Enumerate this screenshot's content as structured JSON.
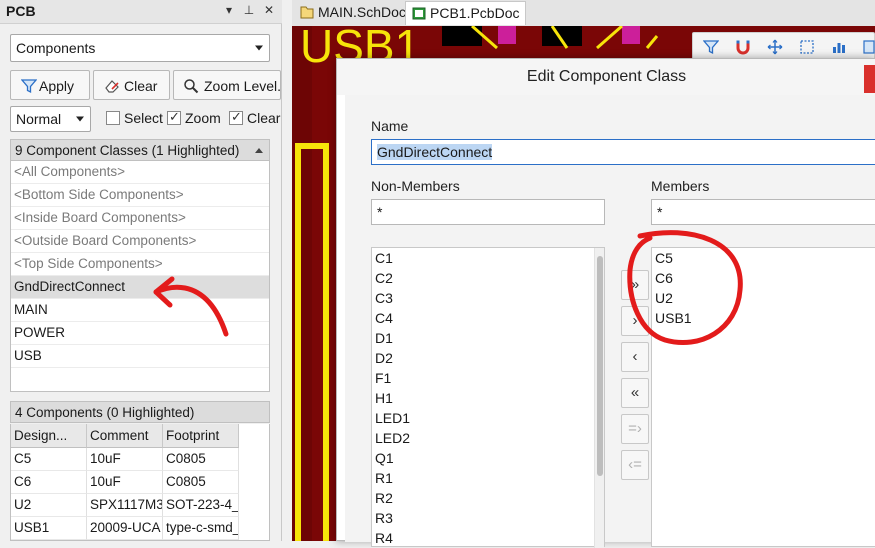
{
  "panel": {
    "title": "PCB",
    "header_buttons": [
      "▾",
      "⊥",
      "✕"
    ],
    "mode_select": "Components",
    "apply_label": "Apply",
    "clear_label": "Clear",
    "zoom_level_label": "Zoom Level...",
    "mask_mode": "Normal",
    "checkboxes": [
      {
        "label": "Select",
        "checked": false
      },
      {
        "label": "Zoom",
        "checked": true
      },
      {
        "label": "Clear",
        "checked": true
      }
    ]
  },
  "classes": {
    "header": "9 Component Classes (1 Highlighted)",
    "items": [
      {
        "label": "<All Components>",
        "special": true
      },
      {
        "label": "<Bottom Side Components>",
        "special": true
      },
      {
        "label": "<Inside Board Components>",
        "special": true
      },
      {
        "label": "<Outside Board Components>",
        "special": true
      },
      {
        "label": "<Top Side Components>",
        "special": true
      },
      {
        "label": "GndDirectConnect",
        "selected": true
      },
      {
        "label": "MAIN"
      },
      {
        "label": "POWER"
      },
      {
        "label": "USB"
      }
    ]
  },
  "components": {
    "header": "4 Components (0 Highlighted)",
    "columns": [
      "Design...",
      "Comment",
      "Footprint"
    ],
    "rows": [
      [
        "C5",
        "10uF",
        "C0805"
      ],
      [
        "C6",
        "10uF",
        "C0805"
      ],
      [
        "U2",
        "SPX1117M3",
        "SOT-223-4_"
      ],
      [
        "USB1",
        "20009-UCA",
        "type-c-smd_"
      ]
    ]
  },
  "tabs": [
    {
      "label": "MAIN.SchDoc",
      "active": false
    },
    {
      "label": "PCB1.PcbDoc",
      "active": true
    }
  ],
  "canvas": {
    "background_color": "#7a0606",
    "trace_color": "#f7e40a",
    "silk_text": "USB1"
  },
  "dialog": {
    "title": "Edit Component Class",
    "name_label": "Name",
    "name_value": "GndDirectConnect",
    "non_members_label": "Non-Members",
    "non_members_filter": "*",
    "members_label": "Members",
    "members_filter": "*",
    "non_members": [
      "C1",
      "C2",
      "C3",
      "C4",
      "D1",
      "D2",
      "F1",
      "H1",
      "LED1",
      "LED2",
      "Q1",
      "R1",
      "R2",
      "R3",
      "R4"
    ],
    "members": [
      "C5",
      "C6",
      "U2",
      "USB1"
    ],
    "move_buttons": [
      "»",
      "›",
      "‹",
      "«",
      "=›",
      "‹="
    ]
  },
  "annotation_color": "#e31b1b"
}
